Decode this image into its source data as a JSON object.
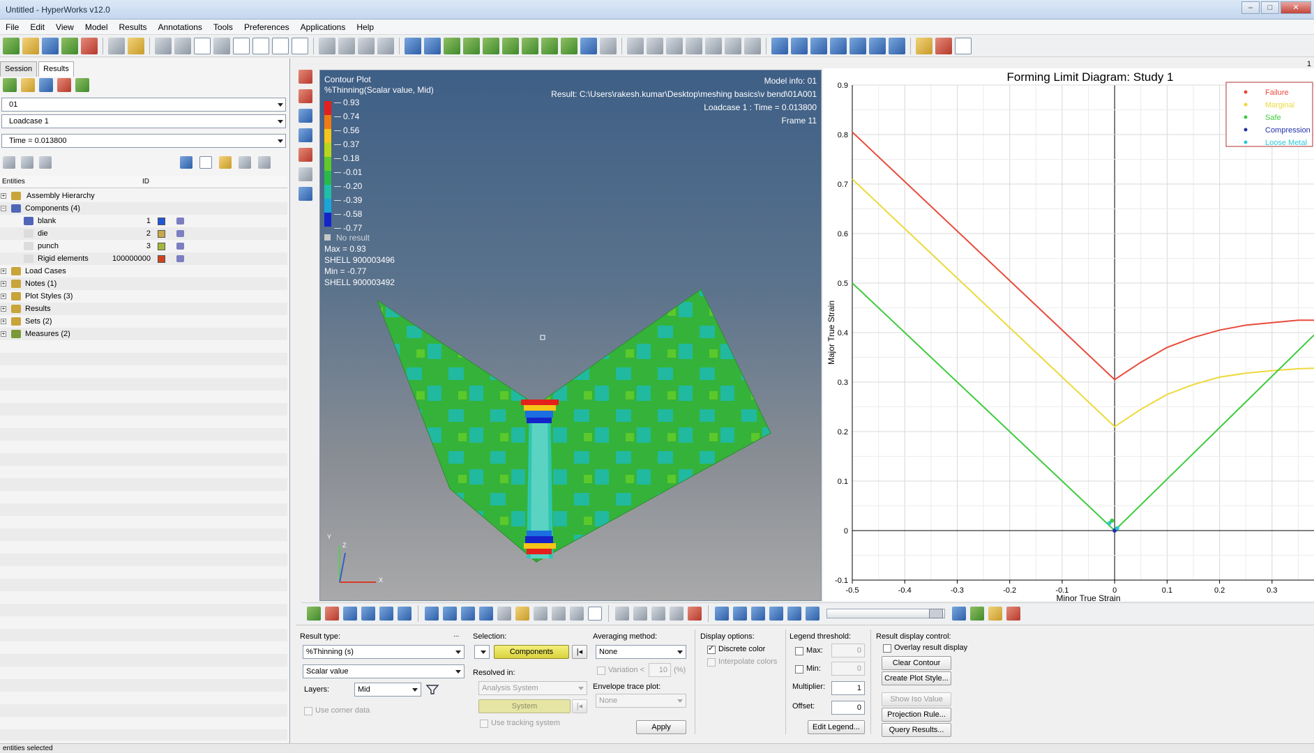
{
  "window": {
    "title": "Untitled - HyperWorks v12.0"
  },
  "menu": [
    "File",
    "Edit",
    "View",
    "Model",
    "Results",
    "Annotations",
    "Tools",
    "Preferences",
    "Applications",
    "Help"
  ],
  "browser": {
    "tabs": [
      "Session",
      "Results"
    ],
    "model_combo": "01",
    "loadcase_combo": "Loadcase 1",
    "time_combo": "Time = 0.013800",
    "col_entities": "Entities",
    "col_id": "ID",
    "tree": {
      "assembly": "Assembly Hierarchy",
      "components": "Components (4)",
      "blank": {
        "name": "blank",
        "id": "1",
        "color": "#1f57d6"
      },
      "die": {
        "name": "die",
        "id": "2",
        "color": "#c7a84a"
      },
      "punch": {
        "name": "punch",
        "id": "3",
        "color": "#a3b83a"
      },
      "rigid": {
        "name": "Rigid elements",
        "id": "100000000",
        "color": "#d1411e"
      },
      "load_cases": "Load Cases",
      "notes": "Notes (1)",
      "plot_styles": "Plot Styles (3)",
      "results": "Results",
      "sets": "Sets  (2)",
      "measures": "Measures (2)"
    }
  },
  "viewport": {
    "title": "Contour Plot",
    "subtitle": "%Thinning(Scalar value, Mid)",
    "model_info": "Model info: 01",
    "result_path": "Result:  C:\\Users\\rakesh.kumar\\Desktop\\meshing basics\\v bend\\01A001",
    "loadcase_time": "Loadcase 1 : Time = 0.013800",
    "frame": "Frame 11",
    "legend_values": [
      "0.93",
      "0.74",
      "0.56",
      "0.37",
      "0.18",
      "-0.01",
      "-0.20",
      "-0.39",
      "-0.58",
      "-0.77"
    ],
    "legend_colors": [
      "#e3201b",
      "#f07a12",
      "#f5c518",
      "#b9d61a",
      "#5fc92a",
      "#29b84a",
      "#1fc0a6",
      "#1aa5d8",
      "#1c6fe0",
      "#1424c8"
    ],
    "no_result": "No result",
    "max": "Max = 0.93",
    "max_shell": "SHELL 900003496",
    "min": "Min = -0.77",
    "min_shell": "SHELL 900003492",
    "triad_y": "Y",
    "triad_z": "Z",
    "triad_x": "X"
  },
  "chart_data": {
    "type": "line",
    "title": "Forming Limit Diagram: Study 1",
    "xlabel": "Minor True Strain",
    "ylabel": "Major True Strain",
    "xlim": [
      -0.5,
      0.38
    ],
    "ylim": [
      -0.1,
      0.9
    ],
    "xticks": [
      "-0.5",
      "-0.4",
      "-0.3",
      "-0.2",
      "-0.1",
      "0",
      "0.1",
      "0.2",
      "0.3"
    ],
    "yticks": [
      "-0.1",
      "0",
      "0.1",
      "0.2",
      "0.3",
      "0.4",
      "0.5",
      "0.6",
      "0.7",
      "0.8",
      "0.9"
    ],
    "grid": true,
    "legend_position": "top-right",
    "series": [
      {
        "name": "Failure",
        "color": "#e84a3a",
        "x": [
          -0.5,
          0.0,
          0.05,
          0.1,
          0.15,
          0.2,
          0.25,
          0.3,
          0.35,
          0.38
        ],
        "y": [
          0.805,
          0.305,
          0.34,
          0.37,
          0.39,
          0.405,
          0.415,
          0.42,
          0.425,
          0.425
        ]
      },
      {
        "name": "Marginal",
        "color": "#ecd93a",
        "x": [
          -0.5,
          0.0,
          0.05,
          0.1,
          0.15,
          0.2,
          0.25,
          0.3,
          0.35,
          0.38
        ],
        "y": [
          0.71,
          0.21,
          0.245,
          0.275,
          0.295,
          0.31,
          0.318,
          0.323,
          0.327,
          0.328
        ]
      },
      {
        "name": "Safe",
        "color": "#3ecb3e",
        "x": [
          -0.5,
          0.0,
          0.38
        ],
        "y": [
          0.5,
          0.0,
          0.395
        ]
      },
      {
        "name": "Compression",
        "color": "#1f2fa8",
        "x": [],
        "y": []
      },
      {
        "name": "Loose Metal",
        "color": "#2bc8d8",
        "x": [],
        "y": []
      }
    ],
    "points": [
      {
        "x": -0.01,
        "y": 0.015,
        "color": "#2bc8d8"
      },
      {
        "x": 0.0,
        "y": 0.0,
        "color": "#1f2fa8"
      },
      {
        "x": -0.005,
        "y": 0.02,
        "color": "#3ecb3e"
      },
      {
        "x": 0.005,
        "y": 0.005,
        "color": "#2bc8d8"
      }
    ]
  },
  "panel": {
    "result_type_label": "Result type:",
    "result_type_value": "%Thinning (s)",
    "result_sub_value": "Scalar value",
    "layers_label": "Layers:",
    "layers_value": "Mid",
    "use_corner": "Use corner data",
    "selection_label": "Selection:",
    "selection_value": "Components",
    "resolved_label": "Resolved in:",
    "resolved_value": "Analysis System",
    "system_button": "System",
    "tracking": "Use tracking system",
    "averaging_label": "Averaging method:",
    "averaging_value": "None",
    "variation_label": "Variation <",
    "variation_value": "10",
    "variation_unit": "(%)",
    "envelope_label": "Envelope trace plot:",
    "envelope_value": "None",
    "apply": "Apply",
    "display_label": "Display options:",
    "discrete": "Discrete color",
    "interpolate": "Interpolate colors",
    "legend_label": "Legend threshold:",
    "max_label": "Max:",
    "max_value": "0",
    "min_label": "Min:",
    "min_value": "0",
    "multiplier_label": "Multiplier:",
    "multiplier_value": "1",
    "offset_label": "Offset:",
    "offset_value": "0",
    "edit_legend": "Edit Legend...",
    "rdc_label": "Result display control:",
    "overlay": "Overlay result display",
    "clear_contour": "Clear Contour",
    "create_plot_style": "Create Plot Style...",
    "show_iso": "Show Iso Value",
    "projection": "Projection Rule...",
    "query": "Query Results..."
  },
  "status": "entities selected",
  "page_number": "1"
}
